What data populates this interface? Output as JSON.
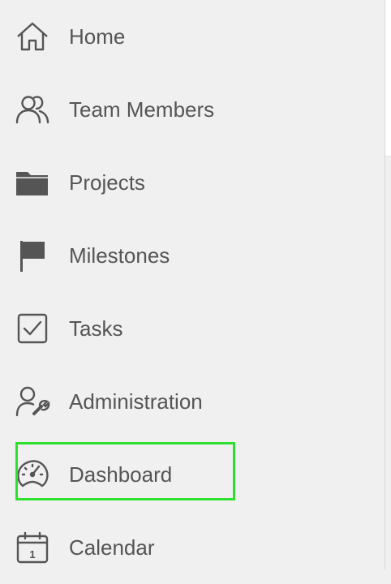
{
  "sidebar": {
    "items": [
      {
        "label": "Home",
        "icon": "home-icon"
      },
      {
        "label": "Team Members",
        "icon": "team-members-icon"
      },
      {
        "label": "Projects",
        "icon": "folder-icon"
      },
      {
        "label": "Milestones",
        "icon": "flag-icon"
      },
      {
        "label": "Tasks",
        "icon": "checkbox-icon"
      },
      {
        "label": "Administration",
        "icon": "admin-user-wrench-icon"
      },
      {
        "label": "Dashboard",
        "icon": "dashboard-gauge-icon"
      },
      {
        "label": "Calendar",
        "icon": "calendar-icon"
      }
    ],
    "highlighted_item": "Dashboard",
    "calendar_icon_day": "1"
  },
  "colors": {
    "text": "#555555",
    "icon": "#555555",
    "background": "#f0f0f0",
    "highlight_border": "#2ee02e"
  }
}
